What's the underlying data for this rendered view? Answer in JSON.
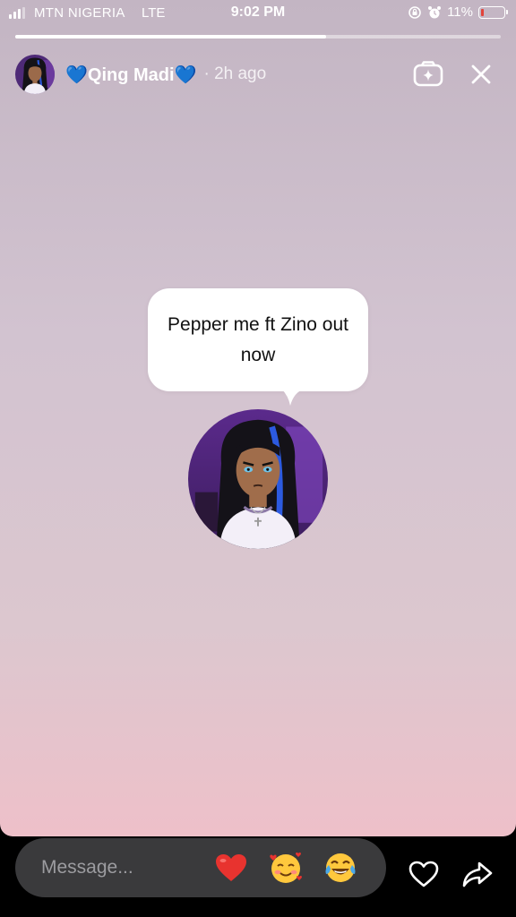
{
  "status_bar": {
    "carrier": "MTN NIGERIA",
    "network": "LTE",
    "time": "9:02 PM",
    "battery": "11%",
    "battery_level": 0.11
  },
  "story": {
    "progress": 0.64,
    "username": "💙Qing Madi💙",
    "time_ago": "· 2h ago",
    "note_text": "Pepper me ft Zino out now",
    "background_top": "#c3b5c3",
    "background_bottom": "#eec0c9"
  },
  "reply": {
    "placeholder": "Message...",
    "reactions": [
      "❤️",
      "🥰",
      "😂"
    ]
  },
  "icons": {
    "header": [
      "effects-sparkle-icon",
      "close-icon"
    ],
    "footer": [
      "heart-outline-icon",
      "share-arrow-icon"
    ]
  }
}
